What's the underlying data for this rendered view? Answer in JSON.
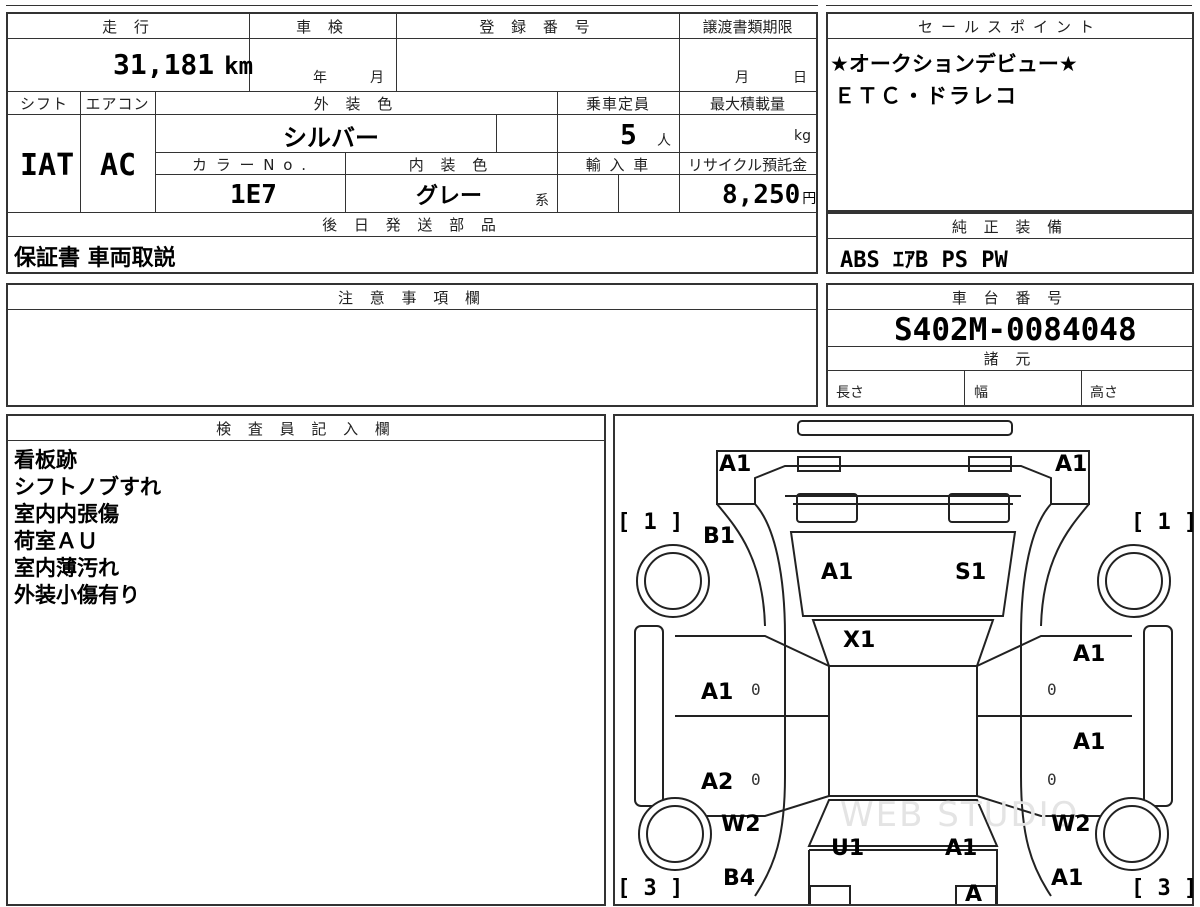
{
  "header": {
    "mileage_label": "走 行",
    "mileage_value": "31,181",
    "mileage_unit": "km",
    "inspection_label": "車 検",
    "inspection_year": "年",
    "inspection_month": "月",
    "registration_label": "登 録 番 号",
    "transfer_label": "譲渡書類期限",
    "transfer_month": "月",
    "transfer_day": "日"
  },
  "specs": {
    "shift_label": "シフト",
    "shift_value": "IAT",
    "aircon_label": "エアコン",
    "aircon_value": "AC",
    "exterior_label": "外 装 色",
    "exterior_value": "シルバー",
    "capacity_label": "乗車定員",
    "capacity_value": "5",
    "capacity_unit": "人",
    "maxload_label": "最大積載量",
    "maxload_unit": "kg",
    "color_no_label": "カ ラ ー N o .",
    "color_no_value": "1E7",
    "interior_label": "内 装 色",
    "interior_value": "グレー",
    "interior_suffix": "系",
    "import_label": "輸 入 車",
    "recycle_label": "リサイクル預託金",
    "recycle_value": "8,250",
    "recycle_unit": "円"
  },
  "later_parts": {
    "label": "後 日 発 送 部 品",
    "value": "保証書 車両取説"
  },
  "notes": {
    "label": "注 意 事 項 欄",
    "value": ""
  },
  "sales_points": {
    "label": "セールスポイント",
    "lines": [
      "★オークションデビュー★",
      "ＥＴＣ・ドラレコ"
    ]
  },
  "equipment": {
    "label": "純 正 装 備",
    "value": "ABS ｴｱB PS PW"
  },
  "chassis": {
    "label": "車 台 番 号",
    "value": "S402M-0084048"
  },
  "dimensions": {
    "label": "諸 元",
    "length": "長さ",
    "width": "幅",
    "height": "高さ"
  },
  "inspector": {
    "label": "検 査 員 記 入 欄",
    "lines": [
      "看板跡",
      "シフトノブすれ",
      "室内内張傷",
      "荷室ＡＵ",
      "室内薄汚れ",
      "外装小傷有り"
    ]
  },
  "diagram": {
    "labels": {
      "front_left": "A1",
      "front_right": "A1",
      "fender_left": "B1",
      "hood_left": "A1",
      "hood_right": "S1",
      "windshield": "X1",
      "front_door_left": "A1",
      "front_door_right": "A1",
      "rear_door_left": "A2",
      "rear_door_right": "A1",
      "quarter_left": "W2",
      "quarter_right": "W2",
      "roof_left": "U1",
      "roof_right": "A1",
      "rear_left": "B4",
      "rear_right": "A1",
      "rear_center": "A"
    },
    "zeros": [
      "0",
      "0",
      "0",
      "0"
    ],
    "bracket_fl": "[ 1 ]",
    "bracket_fr": "[ 1 ]",
    "bracket_rl": "[ 3 ]",
    "bracket_rr": "[ 3 ]",
    "watermark": "WEB STUDIO"
  }
}
